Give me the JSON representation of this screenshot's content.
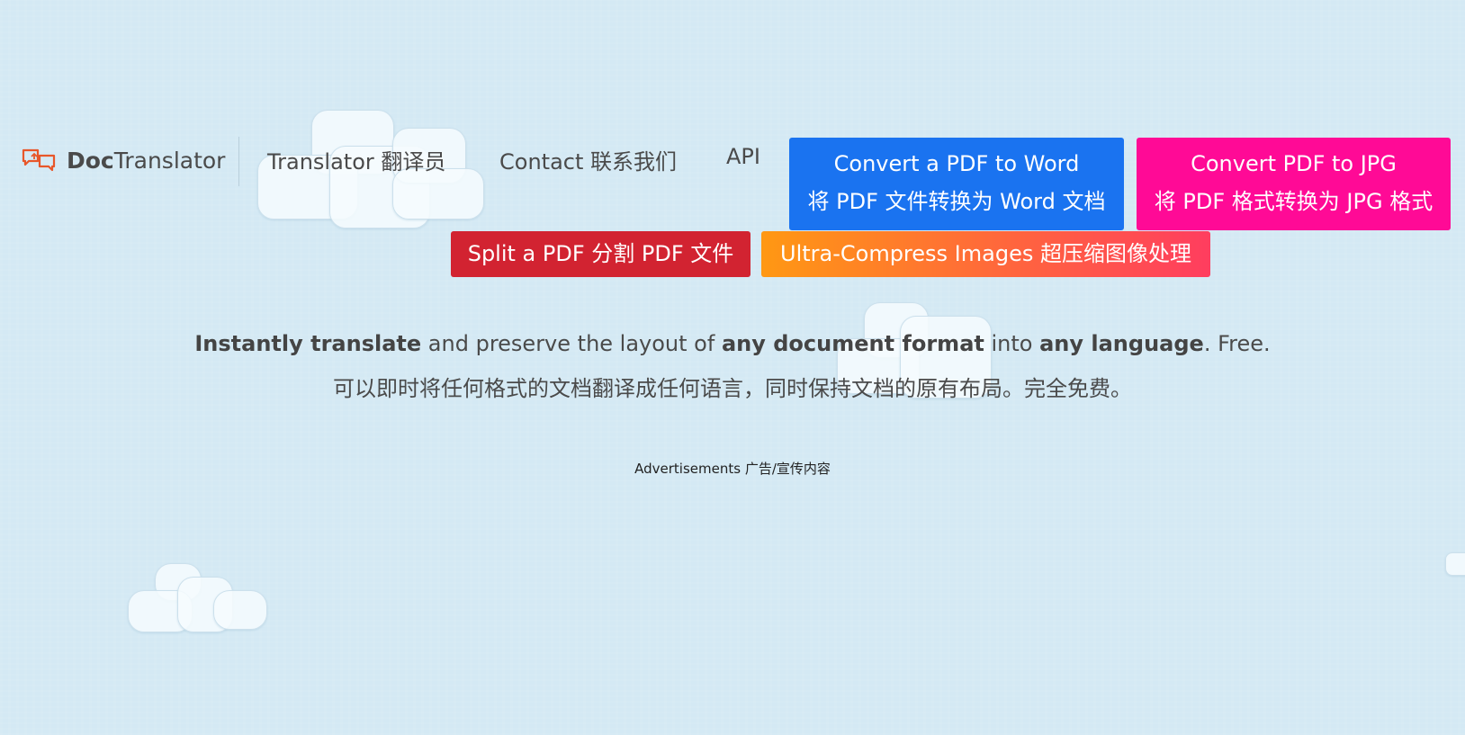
{
  "logo": {
    "part_bold": "Doc",
    "part_regular": "Translator",
    "icon": "speech-bubbles-icon",
    "accent": "#e8572a"
  },
  "nav": {
    "translator": "Translator  翻译员",
    "contact": "Contact  联系我们",
    "api": "API"
  },
  "buttons": {
    "pdf_to_word": {
      "line1": "Convert a PDF to Word",
      "line2": "将 PDF 文件转换为 Word 文档",
      "color": "#1a73f0"
    },
    "pdf_to_jpg": {
      "line1": "Convert PDF to JPG",
      "line2": "将 PDF 格式转换为 JPG 格式",
      "color": "#ff0a96"
    },
    "split_pdf": {
      "label": "Split a PDF  分割 PDF 文件",
      "color": "#d22331"
    },
    "compress_images": {
      "label": "Ultra-Compress Images  超压缩图像处理",
      "gradient": [
        "#ff9813",
        "#ff3d5f"
      ]
    }
  },
  "tagline": {
    "en": {
      "b1": "Instantly translate",
      "r1": " and preserve the layout of ",
      "b2": "any document format",
      "r2": " into ",
      "b3": "any language",
      "r3": ". Free."
    },
    "zh": "可以即时将任何格式的文档翻译成任何语言，同时保持文档的原有布局。完全免费。"
  },
  "ads_label": "Advertisements  广告/宣传内容"
}
